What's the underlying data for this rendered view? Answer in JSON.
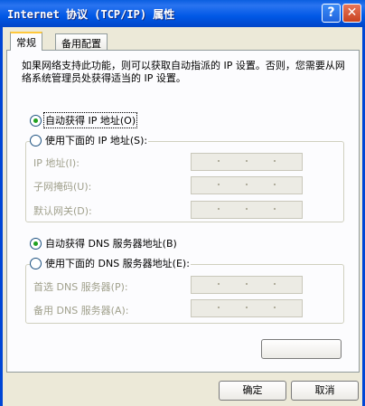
{
  "window": {
    "title": "Internet 协议 (TCP/IP) 属性"
  },
  "titlebar_buttons": {
    "help": "?",
    "close": "✕"
  },
  "tabs": [
    {
      "label": "常规"
    },
    {
      "label": "备用配置"
    }
  ],
  "description": "如果网络支持此功能，则可以获取自动指派的 IP 设置。否则，您需要从网络系统管理员处获得适当的 IP 设置。",
  "ip_section": {
    "auto_label": "自动获得 IP 地址(O)",
    "manual_label": "使用下面的 IP 地址(S):",
    "auto_checked": true,
    "fields": [
      {
        "label": "IP 地址(I):"
      },
      {
        "label": "子网掩码(U):"
      },
      {
        "label": "默认网关(D):"
      }
    ]
  },
  "dns_section": {
    "auto_label": "自动获得 DNS 服务器地址(B)",
    "manual_label": "使用下面的 DNS 服务器地址(E):",
    "auto_checked": true,
    "fields": [
      {
        "label": "首选 DNS 服务器(P):"
      },
      {
        "label": "备用 DNS 服务器(A):"
      }
    ]
  },
  "buttons": {
    "ok": "确定",
    "cancel": "取消"
  }
}
